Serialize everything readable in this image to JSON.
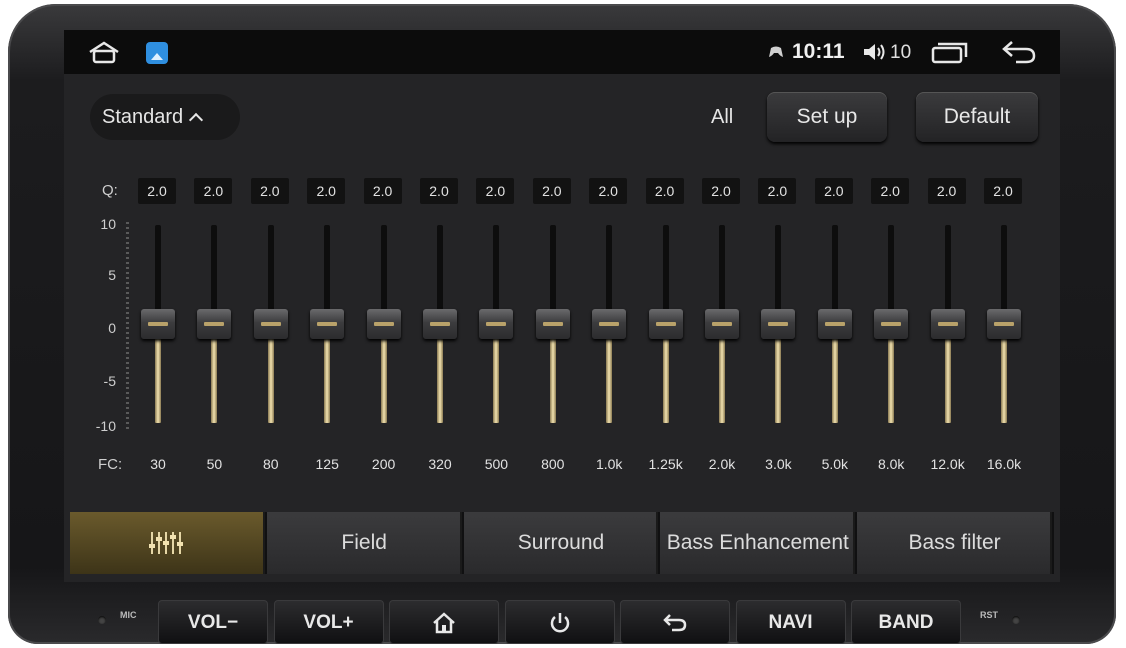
{
  "status_bar": {
    "time": "10:11",
    "volume_level": "10",
    "icons": [
      "home-icon",
      "app-icon",
      "gamepad-icon",
      "volume-icon",
      "recent-apps-icon",
      "back-icon"
    ]
  },
  "header": {
    "preset": "Standard",
    "all_label": "All",
    "setup_label": "Set up",
    "default_label": "Default"
  },
  "equalizer": {
    "q_label": "Q:",
    "fc_label": "FC:",
    "scale": [
      "10",
      "5",
      "0",
      "-5",
      "-10"
    ],
    "gain_range": [
      -10,
      10
    ],
    "bands": [
      {
        "q": "2.0",
        "fc": "30",
        "gain": 0
      },
      {
        "q": "2.0",
        "fc": "50",
        "gain": 0
      },
      {
        "q": "2.0",
        "fc": "80",
        "gain": 0
      },
      {
        "q": "2.0",
        "fc": "125",
        "gain": 0
      },
      {
        "q": "2.0",
        "fc": "200",
        "gain": 0
      },
      {
        "q": "2.0",
        "fc": "320",
        "gain": 0
      },
      {
        "q": "2.0",
        "fc": "500",
        "gain": 0
      },
      {
        "q": "2.0",
        "fc": "800",
        "gain": 0
      },
      {
        "q": "2.0",
        "fc": "1.0k",
        "gain": 0
      },
      {
        "q": "2.0",
        "fc": "1.25k",
        "gain": 0
      },
      {
        "q": "2.0",
        "fc": "2.0k",
        "gain": 0
      },
      {
        "q": "2.0",
        "fc": "3.0k",
        "gain": 0
      },
      {
        "q": "2.0",
        "fc": "5.0k",
        "gain": 0
      },
      {
        "q": "2.0",
        "fc": "8.0k",
        "gain": 0
      },
      {
        "q": "2.0",
        "fc": "12.0k",
        "gain": 0
      },
      {
        "q": "2.0",
        "fc": "16.0k",
        "gain": 0
      }
    ],
    "slider_color": "#f2e2b0"
  },
  "tabs": [
    {
      "label": "",
      "icon": "equalizer-icon",
      "active": true
    },
    {
      "label": "Field",
      "active": false
    },
    {
      "label": "Surround",
      "active": false
    },
    {
      "label": "Bass Enhancement",
      "active": false
    },
    {
      "label": "Bass filter",
      "active": false
    }
  ],
  "hardware_buttons": {
    "mic_label": "MIC",
    "rst_label": "RST",
    "buttons": [
      {
        "label": "VOL−"
      },
      {
        "label": "VOL+"
      },
      {
        "label": "",
        "icon": "home-icon"
      },
      {
        "label": "",
        "icon": "power-icon"
      },
      {
        "label": "",
        "icon": "back-icon"
      },
      {
        "label": "NAVI"
      },
      {
        "label": "BAND"
      }
    ]
  }
}
